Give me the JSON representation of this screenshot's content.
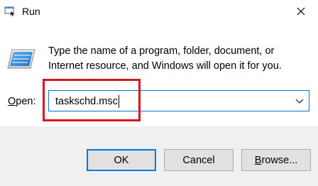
{
  "window": {
    "title": "Run",
    "app_icon": "run-icon",
    "close_icon": "close-icon"
  },
  "dialog": {
    "icon": "run-program-icon",
    "description_lines": [
      "Type the name of a program, folder, document, or",
      "Internet resource, and Windows will open it for you."
    ],
    "open_label_mnemonic": "O",
    "open_label_rest": "pen:",
    "open_value": "taskschd.msc",
    "dropdown_icon": "chevron-down-icon",
    "highlight_color": "#d9161e",
    "focus_color": "#0078d7"
  },
  "buttons": {
    "ok": "OK",
    "cancel": "Cancel",
    "browse_mnemonic": "B",
    "browse_rest": "rowse..."
  }
}
